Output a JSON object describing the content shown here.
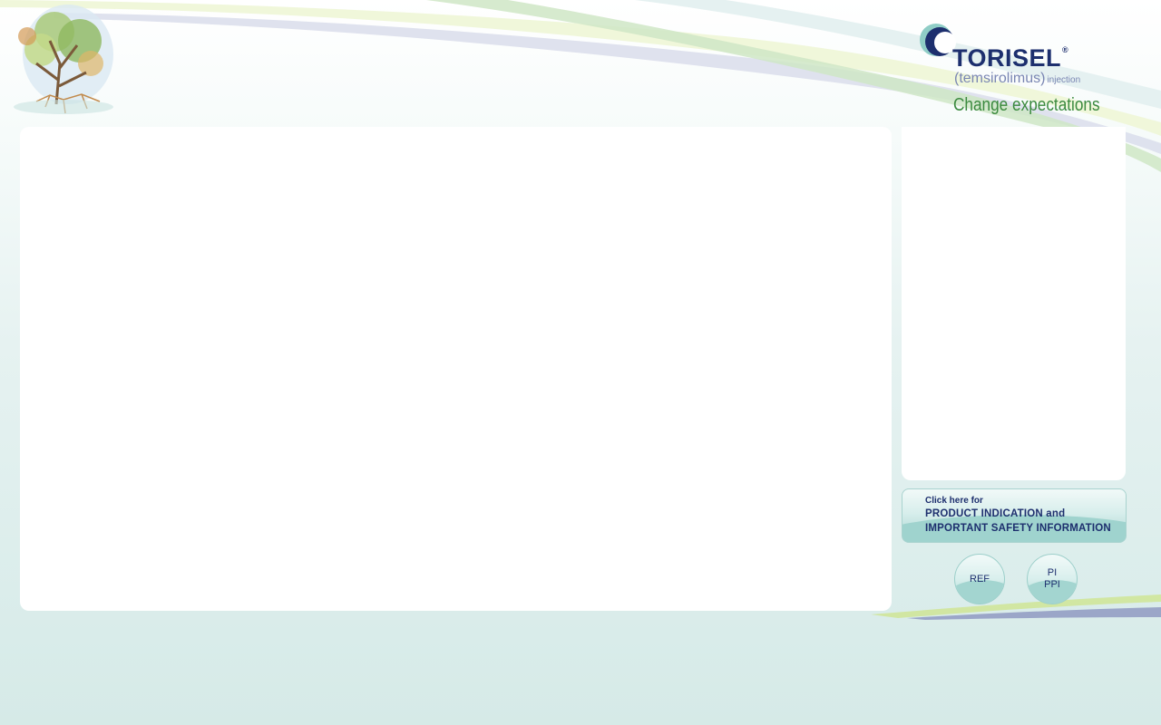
{
  "brand": {
    "name": "TORISEL",
    "registered_mark": "®",
    "generic_name": "(temsirolimus)",
    "form": "injection",
    "tagline": "Change expectations"
  },
  "isi_button": {
    "intro": "Click here for",
    "line1": "PRODUCT INDICATION and",
    "line2": "IMPORTANT SAFETY INFORMATION"
  },
  "nav_buttons": {
    "ref": "REF",
    "pi": "PI",
    "ppi": "PPI"
  },
  "colors": {
    "brand_navy": "#1d2f6e",
    "brand_green": "#3b8a3f",
    "teal_accent": "#a3d5d0",
    "background_teal": "#d6eae7"
  },
  "icons": {
    "tree": "tree-illustration",
    "logo_mark": "torisel-crescent-logo-mark"
  }
}
